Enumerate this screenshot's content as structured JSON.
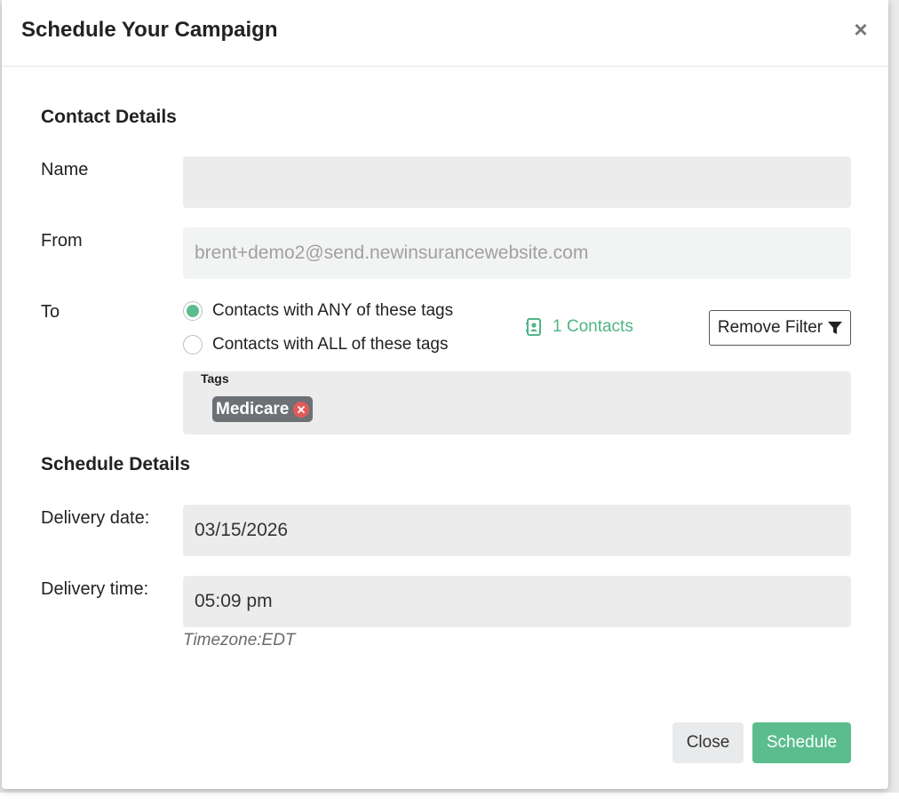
{
  "modal": {
    "title": "Schedule Your Campaign",
    "close_icon": "close-icon"
  },
  "contact_details": {
    "section_title": "Contact Details",
    "name_label": "Name",
    "name_value": "",
    "from_label": "From",
    "from_value": "brent+demo2@send.newinsurancewebsite.com",
    "to_label": "To",
    "to_options": [
      {
        "label": "Contacts with ANY of these tags",
        "checked": true
      },
      {
        "label": "Contacts with ALL of these tags",
        "checked": false
      }
    ],
    "contacts_count": "1 Contacts",
    "contacts_icon": "address-book-icon",
    "remove_filter_label": "Remove Filter",
    "filter_icon": "filter-icon",
    "tags_label": "Tags",
    "tags": [
      "Medicare"
    ]
  },
  "schedule_details": {
    "section_title": "Schedule Details",
    "date_label": "Delivery date:",
    "date_value": "03/15/2026",
    "time_label": "Delivery time:",
    "time_value": "05:09 pm",
    "timezone": "Timezone:EDT"
  },
  "footer": {
    "close_label": "Close",
    "schedule_label": "Schedule"
  },
  "colors": {
    "accent": "#5bbd8e",
    "tag_bg": "#6d7175",
    "tag_remove": "#e25a57",
    "input_bg": "#ececed"
  }
}
